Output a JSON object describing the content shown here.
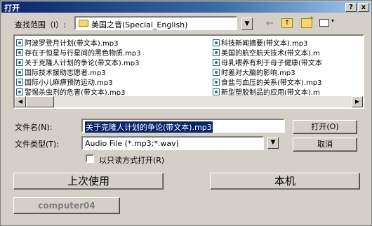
{
  "dialog": {
    "title": "打开",
    "help_btn": "?",
    "close_btn": "x"
  },
  "lookin": {
    "label": "查找范围（I）:",
    "value": "美国之音(Special_English)",
    "icons": [
      "up-folder-icon",
      "new-folder-icon",
      "view-menu-icon"
    ]
  },
  "files_col1": [
    "阿波罗登月计划(带文本).mp3",
    "存在于恒星与行星间的黑色物质.mp3",
    "关于克隆人计划的争论(带文本).mp3",
    "国际技术援助志愿者.mp3",
    "国际小儿麻痹预防运动.mp3",
    "警惕杀虫剂的危害(带文本).mp3"
  ],
  "files_col2": [
    "科技新闻摘要(带文本).mp3",
    "美国的航空航天技术(带文本).m",
    "母乳喂养有利于母子健康(带文本",
    "时差对大脑的影响.mp3",
    "食盐与血压的关系(带文本).mp3",
    "新型塑胶制品的应用(带文本).m"
  ],
  "filename": {
    "label": "文件名(N):",
    "value": "关于克隆人计划的争论(带文本).mp3"
  },
  "filetype": {
    "label": "文件类型(T):",
    "value": "Audio File (*.mp3;*.wav)"
  },
  "buttons": {
    "open": "打开(O)",
    "cancel": "取消"
  },
  "readonly_label": "以只读方式打开(R)",
  "places": {
    "last_used": "上次使用",
    "this_machine": "本机",
    "computer": "computer04"
  }
}
